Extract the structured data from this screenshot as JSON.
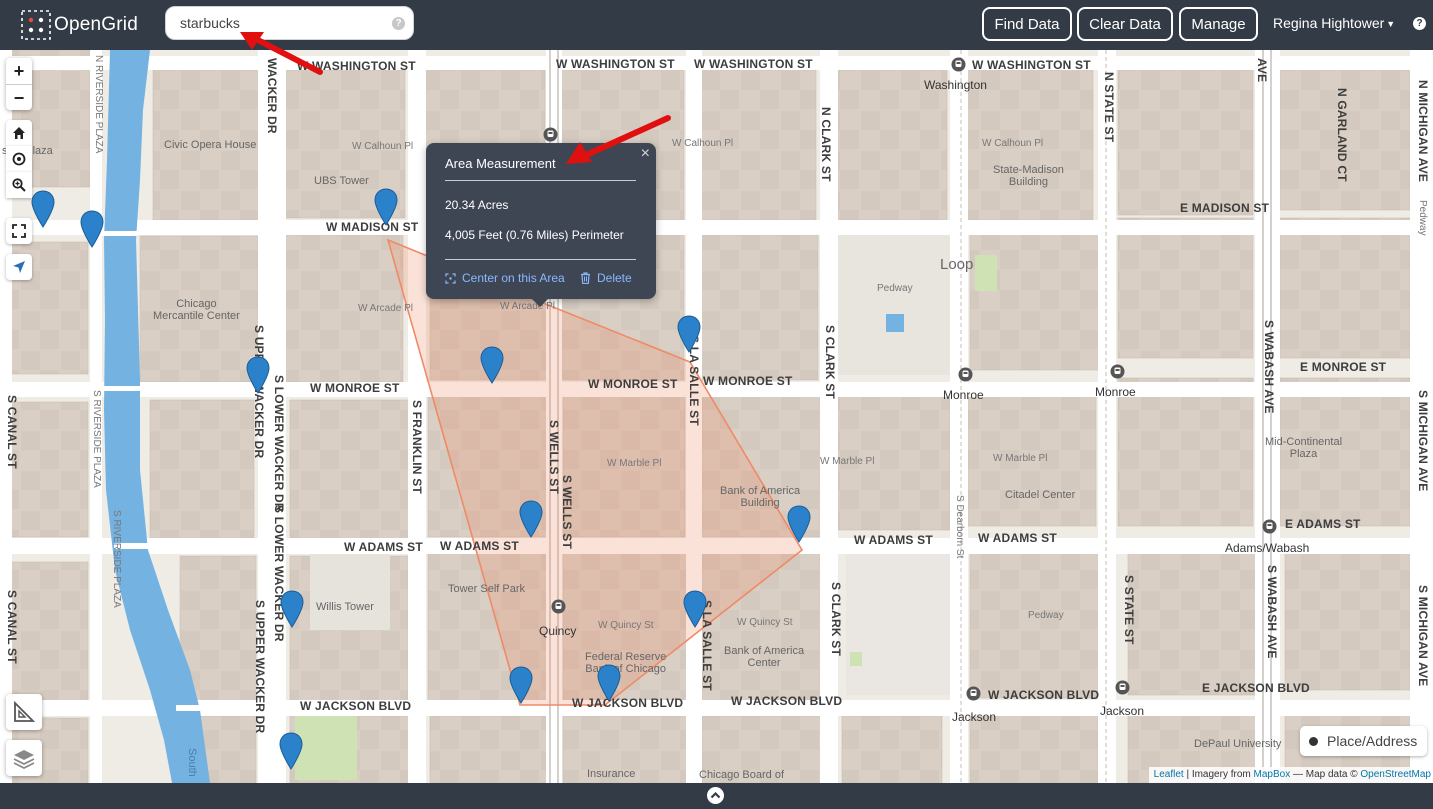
{
  "app": {
    "brand": "OpenGrid"
  },
  "search": {
    "value": "starbucks",
    "help": "?"
  },
  "header": {
    "find_data": "Find Data",
    "clear_data": "Clear Data",
    "manage": "Manage",
    "user": "Regina Hightower",
    "help": "?"
  },
  "map": {
    "zoom_in": "+",
    "zoom_out": "−",
    "streets": {
      "washington_1": "W WASHINGTON ST",
      "washington_2": "W WASHINGTON ST",
      "washington_3": "W WASHINGTON ST",
      "washington_4": "W WASHINGTON ST",
      "madison_1": "W MADISON ST",
      "madison_2": "E MADISON ST",
      "monroe_1": "W MONROE ST",
      "monroe_2": "W MONROE ST",
      "monroe_3": "W MONROE ST",
      "monroe_4": "E MONROE ST",
      "adams_1": "W ADAMS ST",
      "adams_2": "W ADAMS ST",
      "adams_3": "W ADAMS ST",
      "adams_4": "W ADAMS ST",
      "adams_5": "E ADAMS ST",
      "jackson_1": "W JACKSON BLVD",
      "jackson_2": "W JACKSON BLVD",
      "jackson_3": "W JACKSON BLVD",
      "jackson_4": "W JACKSON BLVD",
      "jackson_5": "E JACKSON BLVD",
      "canal_1": "S CANAL ST",
      "canal_2": "S CANAL ST",
      "riverside_1": "N RIVERSIDE PLAZA",
      "riverside_2": "S RIVERSIDE PLAZA",
      "riverside_3": "S RIVERSIDE PLAZA",
      "wacker_1": "WACKER DR",
      "wacker_2": "S UPPER WACKER DR",
      "wacker_3": "S LOWER WACKER DR",
      "wacker_4": "S LOWER WACKER DR",
      "wacker_5": "S UPPER WACKER DR",
      "franklin": "S FRANKLIN ST",
      "wells": "S WELLS ST",
      "wells_2": "S WELLS ST",
      "lasalle_1": "S LA SALLE ST",
      "lasalle_2": "S LA SALLE ST",
      "clark_1": "N CLARK ST",
      "clark_2": "S CLARK ST",
      "clark_3": "S CLARK ST",
      "state_1": "N STATE ST",
      "state_2": "S STATE ST",
      "dearborn": "S Dearborn St",
      "wabash_1": "S WABASH AVE",
      "wabash_2": "S WABASH AVE",
      "wabash_3": "AVE",
      "garland": "N GARLAND CT",
      "michigan_1": "N MICHIGAN AVE",
      "michigan_2": "S MICHIGAN AVE",
      "michigan_3": "S MICHIGAN AVE",
      "pedway_1": "Pedway",
      "pedway_2": "Pedway",
      "pedway_3": "Pedway",
      "calhoun_1": "W Calhoun Pl",
      "calhoun_2": "W Calhoun Pl",
      "calhoun_3": "W Calhoun Pl",
      "arcade_1": "W Arcade Pl",
      "arcade_2": "W Arcade Pl",
      "marble_1": "W Marble Pl",
      "marble_2": "W Marble Pl",
      "marble_3": "W Marble Pl",
      "quincy_1": "W Quincy St",
      "quincy_2": "W Quincy St"
    },
    "pois": {
      "riverside": "side Plaza",
      "civic_opera": "Civic Opera House",
      "ubs": "UBS Tower",
      "cme": "Chicago\nMercantile Center",
      "willis": "Willis Tower",
      "tower_self_park": "Tower Self Park",
      "federal_reserve": "Federal Reserve\nBank of Chicago",
      "boa_building": "Bank of America\nBuilding",
      "boa_center": "Bank of America\nCenter",
      "state_madison": "State-Madison\nBuilding",
      "citadel": "Citadel Center",
      "mid_continental": "Mid-Continental\nPlaza",
      "depaul": "DePaul University",
      "insurance": "Insurance",
      "cbot": "Chicago Board of",
      "loop": "Loop",
      "south": "South"
    },
    "stations": {
      "washington": "Washington",
      "monroe_1": "Monroe",
      "monroe_2": "Monroe",
      "quincy": "Quincy",
      "adams_wabash": "Adams/Wabash",
      "jackson_1": "Jackson",
      "jackson_2": "Jackson"
    },
    "colors": {
      "water": "#74b2e2",
      "building": "#d7ccc1",
      "road": "#ffffff",
      "polygon": "#f08a66",
      "pin": "#2b82cb",
      "park": "#cfe2b3",
      "popup": "#3e4654",
      "annotation_arrow": "#e11010"
    }
  },
  "popup": {
    "title": "Area Measurement",
    "close": "×",
    "acres": "20.34 Acres",
    "perimeter": "4,005 Feet (0.76 Miles) Perimeter",
    "center_action": "Center on this Area",
    "delete_action": "Delete"
  },
  "place_address": "Place/Address",
  "attribution": {
    "leaflet": "Leaflet",
    "imagery_prefix": " | Imagery from ",
    "mapbox": "MapBox",
    "data_prefix": " — Map data © ",
    "osm": "OpenStreetMap"
  }
}
